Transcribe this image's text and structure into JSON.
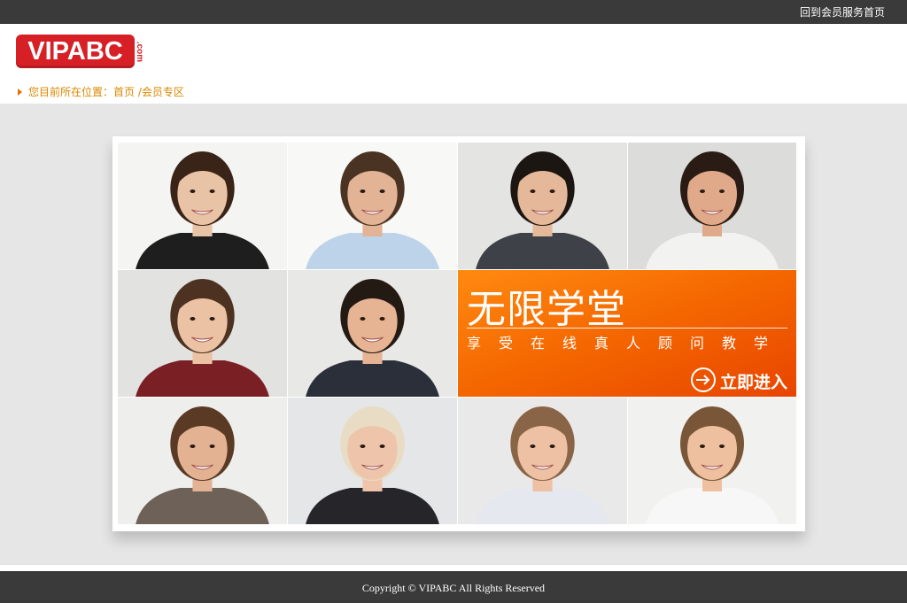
{
  "topbar": {
    "link": "回到会员服务首页"
  },
  "header": {
    "logo_text": "VIPABC",
    "logo_suffix": ".com",
    "breadcrumb": {
      "prefix": "您目前所在位置：",
      "home": "首页",
      "separator": " /",
      "current": "会员专区"
    }
  },
  "promo": {
    "title": "无限学堂",
    "subtitle": "享受在线真人顾问教学",
    "enter_label": "立即进入"
  },
  "portraits": [
    {
      "name": "consultant-1",
      "bg": "#f4f4f2",
      "skin": "#e9c3a6",
      "hair": "#3a2418",
      "shirt": "#1e1e1e"
    },
    {
      "name": "consultant-2",
      "bg": "#f8f8f6",
      "skin": "#e2b395",
      "hair": "#4a3322",
      "shirt": "#bcd3ea"
    },
    {
      "name": "consultant-3",
      "bg": "#e4e4e2",
      "skin": "#e6b89a",
      "hair": "#1c1612",
      "shirt": "#3e4148"
    },
    {
      "name": "consultant-4",
      "bg": "#dcdcda",
      "skin": "#e0aa8a",
      "hair": "#2a1c14",
      "shirt": "#f2f2f0"
    },
    {
      "name": "consultant-5",
      "bg": "#e2e2e0",
      "skin": "#ebc2a4",
      "hair": "#4d3222",
      "shirt": "#7a1f24"
    },
    {
      "name": "consultant-6",
      "bg": "#e8e8e6",
      "skin": "#e6b393",
      "hair": "#241a14",
      "shirt": "#2b2f3a"
    },
    {
      "name": "consultant-7",
      "bg": "#eeeeec",
      "skin": "#e3b293",
      "hair": "#5a3a24",
      "shirt": "#6e6258"
    },
    {
      "name": "consultant-8",
      "bg": "#e4e6e8",
      "skin": "#eec5ab",
      "hair": "#e8dcc4",
      "shirt": "#26262a"
    },
    {
      "name": "consultant-9",
      "bg": "#e9e9e9",
      "skin": "#eec1a4",
      "hair": "#8a6446",
      "shirt": "#e6e8f0"
    },
    {
      "name": "consultant-10",
      "bg": "#f1f1ef",
      "skin": "#eec0a0",
      "hair": "#7a5638",
      "shirt": "#f7f7f7"
    }
  ],
  "colors": {
    "brand_red": "#d71f26",
    "promo_orange": "#f46600",
    "breadcrumb_orange": "#d98800",
    "dark_bar": "#3a3a3a"
  },
  "footer": {
    "copyright": "Copyright © VIPABC All Rights Reserved"
  }
}
